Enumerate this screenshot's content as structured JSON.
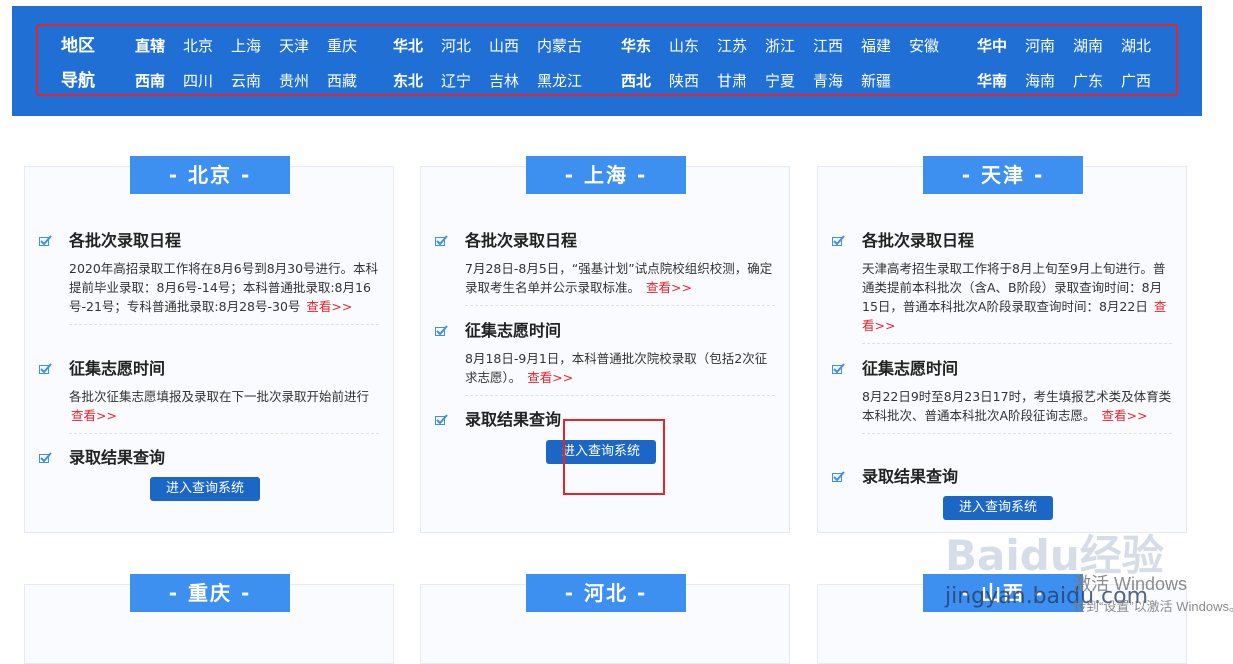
{
  "region_nav": {
    "title_top": "地区",
    "title_bottom": "导航",
    "row1": [
      {
        "label": "直辖",
        "kind": "group"
      },
      {
        "label": "北京",
        "kind": "item"
      },
      {
        "label": "上海",
        "kind": "item"
      },
      {
        "label": "天津",
        "kind": "item"
      },
      {
        "label": "重庆",
        "kind": "item"
      },
      {
        "label": "华北",
        "kind": "group"
      },
      {
        "label": "河北",
        "kind": "item"
      },
      {
        "label": "山西",
        "kind": "item"
      },
      {
        "label": "内蒙古",
        "kind": "item"
      },
      {
        "label": "华东",
        "kind": "group"
      },
      {
        "label": "山东",
        "kind": "item"
      },
      {
        "label": "江苏",
        "kind": "item"
      },
      {
        "label": "浙江",
        "kind": "item"
      },
      {
        "label": "江西",
        "kind": "item"
      },
      {
        "label": "福建",
        "kind": "item"
      },
      {
        "label": "安徽",
        "kind": "item"
      },
      {
        "label": "华中",
        "kind": "group"
      },
      {
        "label": "河南",
        "kind": "item"
      },
      {
        "label": "湖南",
        "kind": "item"
      },
      {
        "label": "湖北",
        "kind": "item"
      }
    ],
    "row2": [
      {
        "label": "西南",
        "kind": "group"
      },
      {
        "label": "四川",
        "kind": "item"
      },
      {
        "label": "云南",
        "kind": "item"
      },
      {
        "label": "贵州",
        "kind": "item"
      },
      {
        "label": "西藏",
        "kind": "item"
      },
      {
        "label": "东北",
        "kind": "group"
      },
      {
        "label": "辽宁",
        "kind": "item"
      },
      {
        "label": "吉林",
        "kind": "item"
      },
      {
        "label": "黑龙江",
        "kind": "item"
      },
      {
        "label": "西北",
        "kind": "group"
      },
      {
        "label": "陕西",
        "kind": "item"
      },
      {
        "label": "甘肃",
        "kind": "item"
      },
      {
        "label": "宁夏",
        "kind": "item"
      },
      {
        "label": "青海",
        "kind": "item"
      },
      {
        "label": "新疆",
        "kind": "item"
      },
      {
        "label": "华南",
        "kind": "group"
      },
      {
        "label": "海南",
        "kind": "item"
      },
      {
        "label": "广东",
        "kind": "item"
      },
      {
        "label": "广西",
        "kind": "item"
      }
    ]
  },
  "cards": [
    {
      "title": "- 北京 -",
      "schedule_title": "各批次录取日程",
      "schedule_text": "2020年高招录取工作将在8月6号到8月30号进行。本科提前毕业录取：8月6号-14号；本科普通批录取:8月16号-21号；专科普通批录取:8月28号-30号",
      "solicit_title": "征集志愿时间",
      "solicit_text": "各批次征集志愿填报及录取在下一批次录取开始前进行",
      "result_title": "录取结果查询",
      "button": "进入查询系统"
    },
    {
      "title": "- 上海 -",
      "schedule_title": "各批次录取日程",
      "schedule_text": "7月28日-8月5日，“强基计划”试点院校组织校测，确定录取考生名单并公示录取标准。",
      "solicit_title": "征集志愿时间",
      "solicit_text": "8月18日-9月1日，本科普通批次院校录取（包括2次征求志愿）。",
      "result_title": "录取结果查询",
      "button": "进入查询系统"
    },
    {
      "title": "- 天津 -",
      "schedule_title": "各批次录取日程",
      "schedule_text": "天津高考招生录取工作将于8月上旬至9月上旬进行。普通类提前本科批次（含A、B阶段）录取查询时间：8月15日，普通本科批次A阶段录取查询时间：8月22日",
      "solicit_title": "征集志愿时间",
      "solicit_text": "8月22日9时至8月23日17时，考生填报艺术类及体育类本科批次、普通本科批次A阶段征询志愿。",
      "result_title": "录取结果查询",
      "button": "进入查询系统"
    }
  ],
  "more_label": "查看>>",
  "bottom_cards": [
    "- 重庆 -",
    "- 河北 -",
    "- 山西 -"
  ],
  "watermark": {
    "logo": "Baidu经验",
    "url": "jingyan.baidu.com",
    "win1": "激活 Windows",
    "win2": "转到“设置”以激活 Windows。"
  },
  "colors": {
    "nav_bg": "#1f6fd4",
    "card_title_bg": "#3d8ff0",
    "button_bg": "#1c67c6",
    "highlight": "#e8232a",
    "more": "#e8232a"
  }
}
